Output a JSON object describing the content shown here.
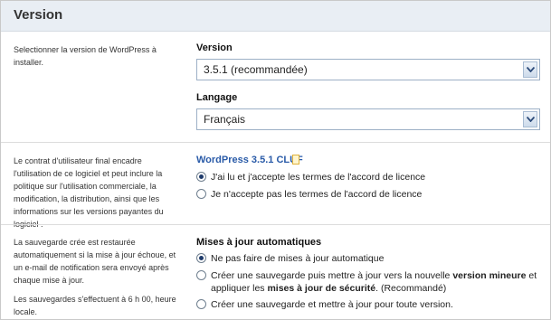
{
  "header": {
    "title": "Version"
  },
  "version_section": {
    "description": "Selectionner la version de WordPress à installer.",
    "version_label": "Version",
    "version_value": "3.5.1 (recommandée)",
    "language_label": "Langage",
    "language_value": "Français"
  },
  "license_section": {
    "description": "Le contrat d'utilisateur final encadre l'utilisation de ce logiciel et peut inclure la politique sur l'utilisation commerciale, la modification, la distribution, ainsi que les informations sur les versions payantes du logiciel .",
    "link": "WordPress 3.5.1 CLUF",
    "options": [
      {
        "label": "J'ai lu et j'accepte les termes de l'accord de licence",
        "checked": true
      },
      {
        "label": "Je n'accepte pas les termes de l'accord de licence",
        "checked": false
      }
    ]
  },
  "update_section": {
    "description": "La sauvegarde crée est restaurée automatiquement si la mise à jour échoue, et un e-mail de notification sera envoyé après chaque mise à jour.",
    "description2": "Les sauvegardes s'effectuent à 6 h 00, heure locale.",
    "title": "Mises à jour automatiques",
    "option1": "Ne pas faire de mises à jour automatique",
    "option2_a": "Créer une sauvegarde puis mettre à jour vers la nouvelle ",
    "option2_b": "version mineure",
    "option2_c": " et",
    "option2_d": "appliquer les ",
    "option2_e": "mises à jour de sécurité",
    "option2_f": ". (Recommandé)",
    "option3": "Créer une sauvegarde et mettre à jour pour toute version."
  }
}
